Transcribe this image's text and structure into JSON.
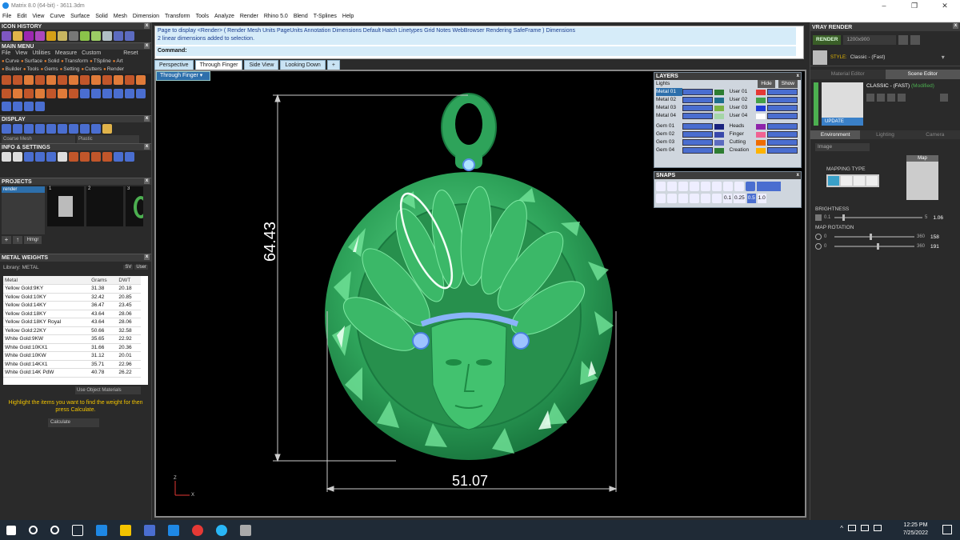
{
  "window": {
    "title": "Matrix 8.0 (64-bit) - 3611.3dm"
  },
  "menu": [
    "File",
    "Edit",
    "View",
    "Curve",
    "Surface",
    "Solid",
    "Mesh",
    "Dimension",
    "Transform",
    "Tools",
    "Analyze",
    "Render",
    "Rhino 5.0",
    "Blend",
    "T-Splines",
    "Help"
  ],
  "left": {
    "icon_history": "ICON HISTORY",
    "main_menu": "MAIN MENU",
    "main_menu_row1": [
      "File",
      "View",
      "Utilities",
      "Measure",
      "Custom"
    ],
    "reset": "Reset",
    "main_menu_row2": [
      "Curve",
      "Surface",
      "Solid",
      "Transform",
      "TSpline",
      "Art"
    ],
    "main_menu_row3": [
      "Builder",
      "Tools",
      "Gems",
      "Setting",
      "Cutters",
      "Render"
    ],
    "display": "DISPLAY",
    "display_mode1": "Coarse Mesh",
    "display_mode2": "Plastic",
    "info_settings": "INFO & SETTINGS",
    "projects": "PROJECTS",
    "project_item": "render",
    "project_slots": [
      "1",
      "2",
      "3"
    ],
    "proj_btn": "Hmgr",
    "metal_weights": "METAL WEIGHTS",
    "library": "Library: METAL",
    "library_opts": [
      "SV",
      "User"
    ],
    "table_headers": [
      "Metal",
      "Grams",
      "DWT"
    ],
    "table_rows": [
      [
        "Yellow Gold:9KY",
        "31.38",
        "20.18"
      ],
      [
        "Yellow Gold:10KY",
        "32.42",
        "20.85"
      ],
      [
        "Yellow Gold:14KY",
        "36.47",
        "23.45"
      ],
      [
        "Yellow Gold:18KY",
        "43.64",
        "28.06"
      ],
      [
        "Yellow Gold:18KY Royal",
        "43.64",
        "28.06"
      ],
      [
        "Yellow Gold:22KY",
        "50.66",
        "32.58"
      ],
      [
        "White Gold:9KW",
        "35.65",
        "22.92"
      ],
      [
        "White Gold:10KX1",
        "31.66",
        "20.36"
      ],
      [
        "White Gold:10KW",
        "31.12",
        "20.01"
      ],
      [
        "White Gold:14KX1",
        "35.71",
        "22.96"
      ],
      [
        "White Gold:14K PdW",
        "40.78",
        "26.22"
      ]
    ],
    "use_object_materials": "Use Object Materials",
    "hint": "Highlight the items you want to find the weight for then press Calculate.",
    "calculate": "Calculate"
  },
  "command": {
    "line1": "Page to display <Render> ( Render  Mesh  Units  PageUnits  Annotation  Dimensions  Default  Hatch  Linetypes  Grid  Notes  WebBrowser  Rendering  SafeFrame )  Dimensions",
    "line2": "2 linear dimensions added to selection.",
    "prompt": "Command:"
  },
  "tabs": [
    "Perspective",
    "Through Finger",
    "Side View",
    "Looking Down",
    "+"
  ],
  "active_tab": "Through Finger",
  "viewport_label": "Through Finger",
  "dimensions": {
    "vertical": "64.43",
    "horizontal": "51.07"
  },
  "axis": {
    "z": "Z",
    "x": "X"
  },
  "layers": {
    "title": "LAYERS",
    "lights": "Lights",
    "hide": "Hide",
    "show": "Show",
    "left": [
      {
        "name": "Metal 01",
        "color": "#2e7d32"
      },
      {
        "name": "Metal 02",
        "color": "#1e6e8c"
      },
      {
        "name": "Metal 03",
        "color": "#7cb342"
      },
      {
        "name": "Metal 04",
        "color": "#a5d6a7"
      },
      {
        "name": "Gem 01",
        "color": "#1a237e"
      },
      {
        "name": "Gem 02",
        "color": "#3949ab"
      },
      {
        "name": "Gem 03",
        "color": "#5c6bc0"
      },
      {
        "name": "Gem 04",
        "color": "#2e7d32"
      }
    ],
    "right": [
      {
        "name": "User 01",
        "color": "#e53935"
      },
      {
        "name": "User 02",
        "color": "#43a047"
      },
      {
        "name": "User 03",
        "color": "#1e3bd6"
      },
      {
        "name": "User 04",
        "color": "#ffffff"
      },
      {
        "name": "Heads",
        "color": "#8e24aa"
      },
      {
        "name": "Finger",
        "color": "#f06292"
      },
      {
        "name": "Cutting",
        "color": "#ef6c00"
      },
      {
        "name": "Creation",
        "color": "#ffb300"
      }
    ]
  },
  "snaps": {
    "title": "SNAPS",
    "values": [
      "0.1",
      "0.25",
      "0.5",
      "1.0"
    ]
  },
  "vray": {
    "title": "VRAY RENDER",
    "render": "RENDER",
    "resolution": "1200x900",
    "style_label": "STYLE:",
    "style_value": "Classic - (Fast)",
    "tabs": [
      "Material Editor",
      "Scene Editor"
    ],
    "classic": "CLASSIC - (FAST)",
    "modified": "(Modified)",
    "update": "UPDATE",
    "env_tabs": [
      "Environment",
      "Lighting",
      "Camera"
    ],
    "env_select": "Image",
    "map": "Map",
    "mapping_type": "MAPPING TYPE",
    "brightness": "BRIGHTNESS",
    "bright_min": "0.1",
    "bright_max": "5",
    "bright_val": "1.06",
    "map_rotation": "MAP ROTATION",
    "rot1_min": "0",
    "rot1_max": "360",
    "rot1_val": "158",
    "rot2_min": "0",
    "rot2_max": "360",
    "rot2_val": "191"
  },
  "taskbar": {
    "time": "12:25 PM",
    "date": "7/25/2022"
  }
}
